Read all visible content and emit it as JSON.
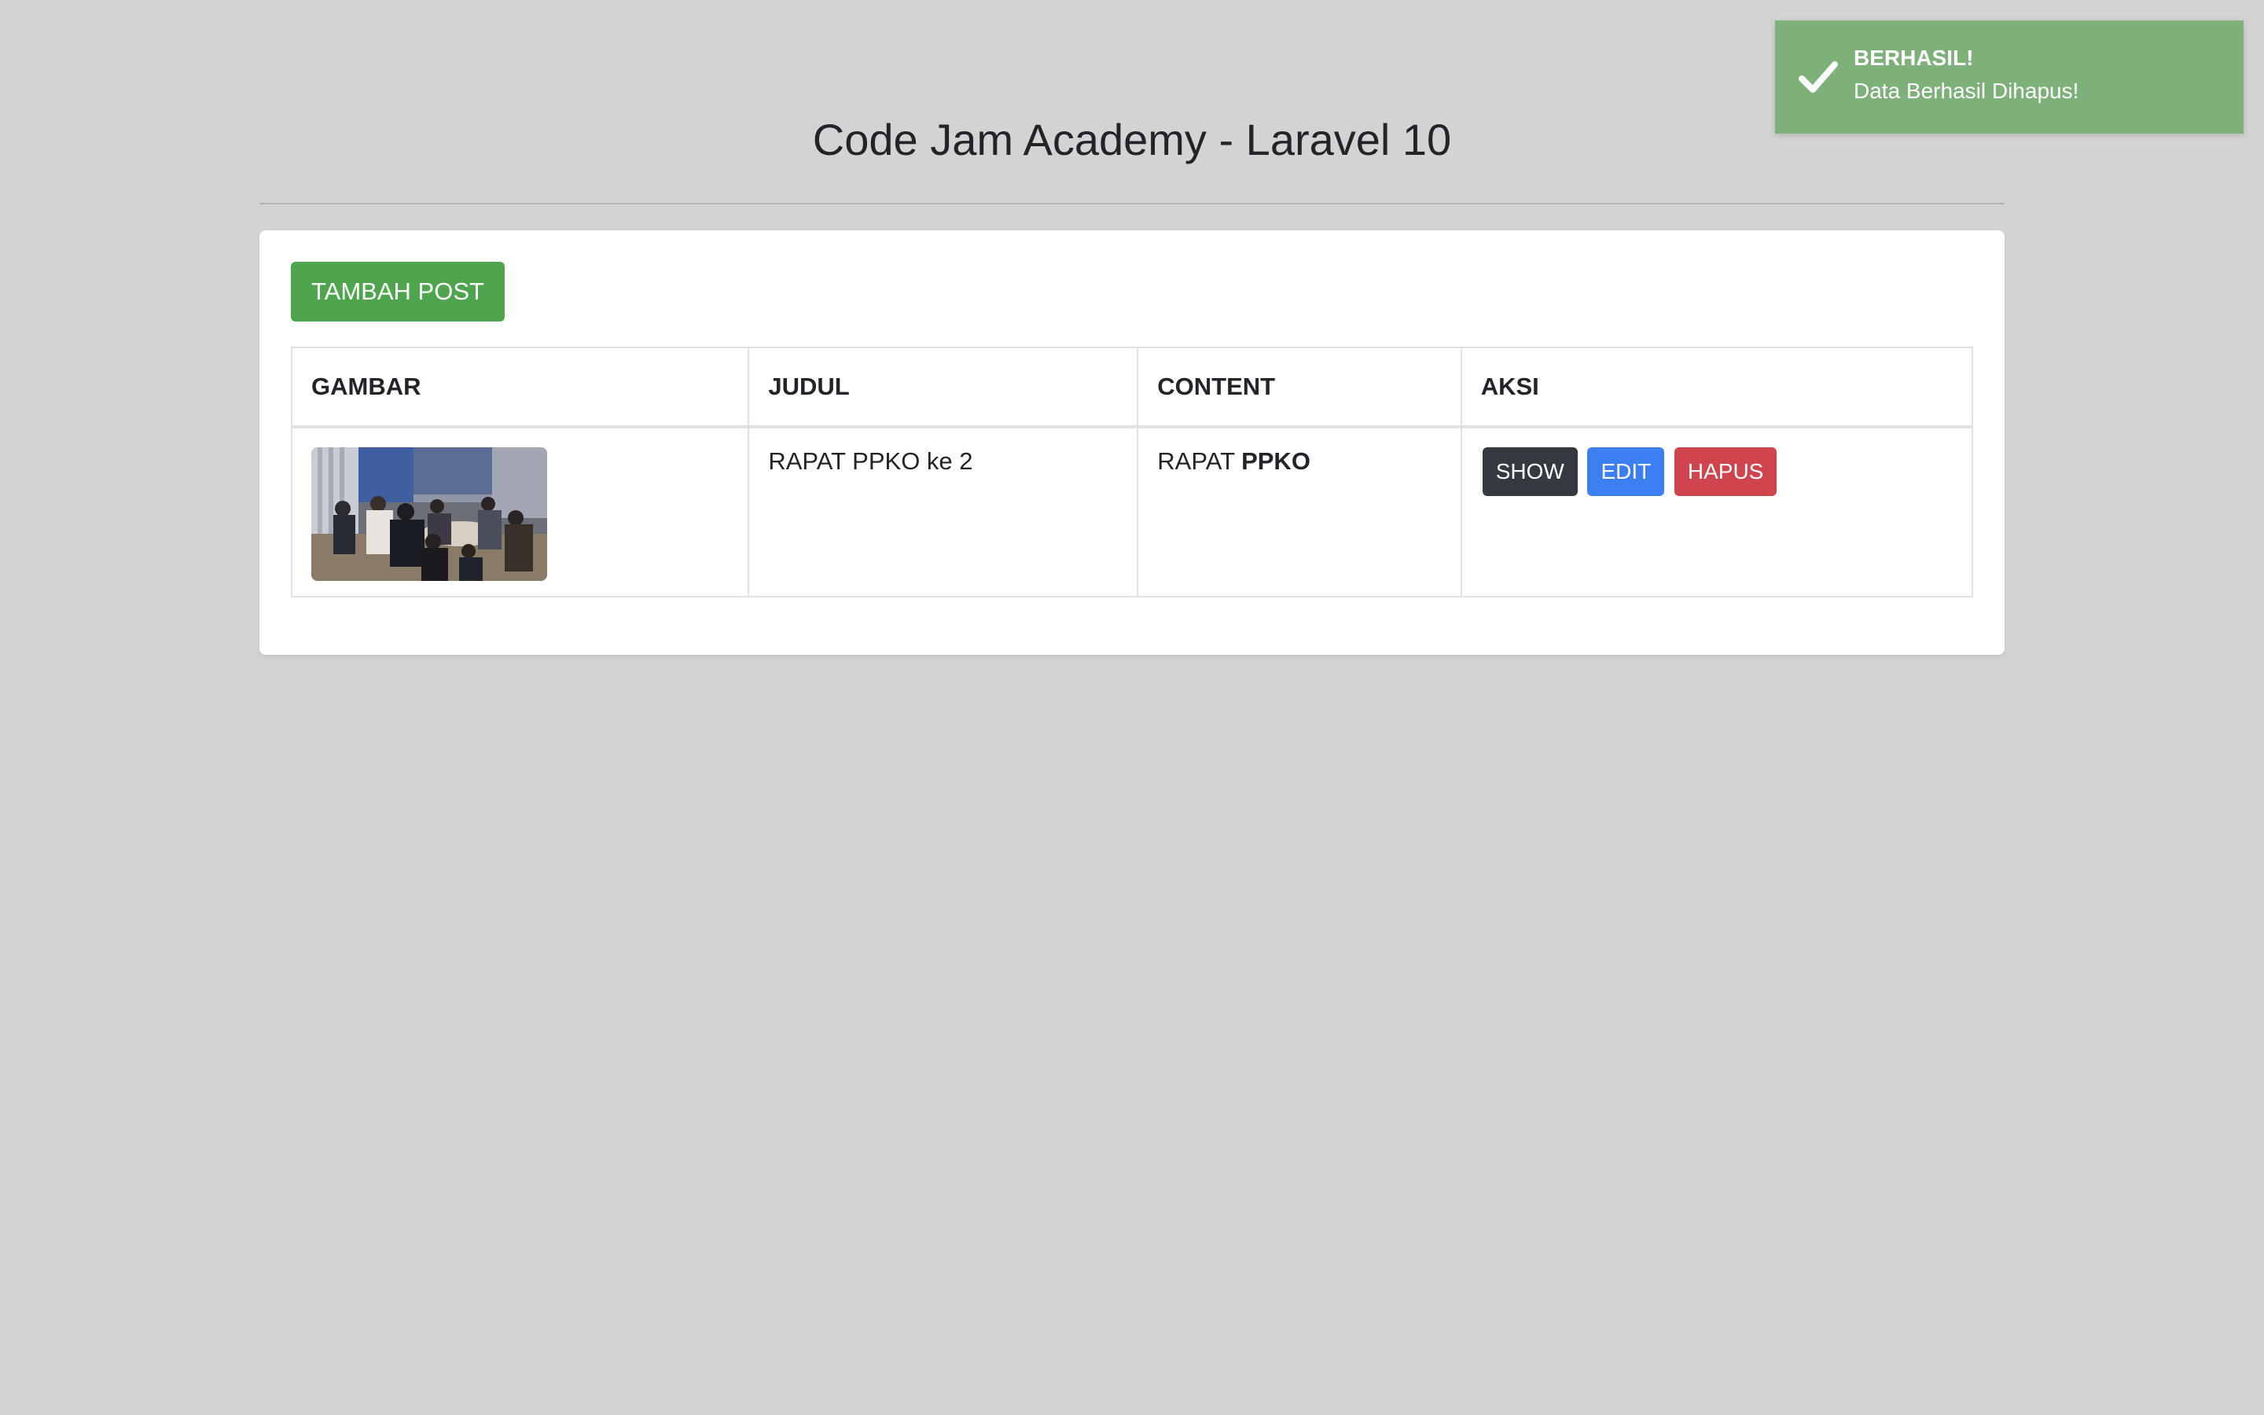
{
  "page": {
    "title": "Code Jam Academy - Laravel 10"
  },
  "toolbar": {
    "add_label": "TAMBAH POST"
  },
  "table": {
    "headers": [
      "GAMBAR",
      "JUDUL",
      "CONTENT",
      "AKSI"
    ],
    "rows": [
      {
        "image_icon": "photo-meeting-image",
        "judul": "RAPAT PPKO ke 2",
        "content_prefix": "RAPAT ",
        "content_bold": "PPKO",
        "actions": {
          "show": "SHOW",
          "edit": "EDIT",
          "hapus": "HAPUS"
        }
      }
    ]
  },
  "toast": {
    "icon": "check-icon",
    "title": "BERHASIL!",
    "message": "Data Berhasil Dihapus!",
    "color": "#7eb07a"
  },
  "colors": {
    "background": "#d3d3d3",
    "add_button": "#4ea54e",
    "show_button": "#343a40",
    "edit_button": "#3b7ff2",
    "hapus_button": "#d0444d"
  }
}
